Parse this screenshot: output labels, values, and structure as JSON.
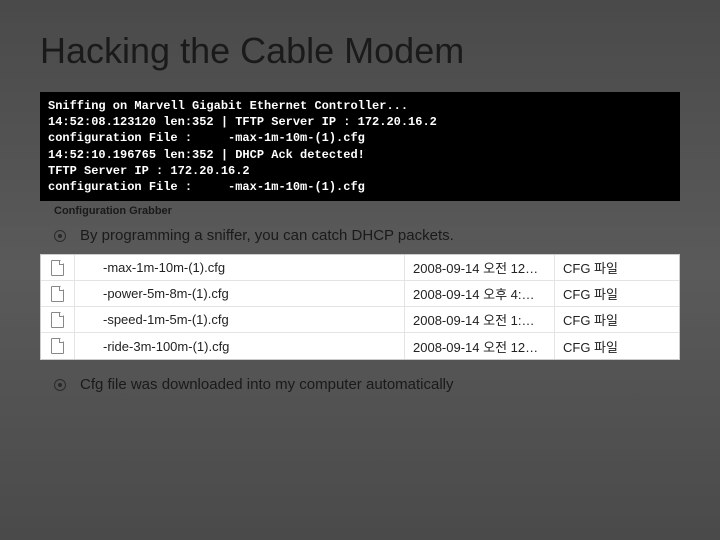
{
  "title": "Hacking the Cable Modem",
  "terminal": {
    "line1": "Sniffing on Marvell Gigabit Ethernet Controller...",
    "line2": "14:52:08.123120 len:352 | TFTP Server IP : 172.20.16.2",
    "line3": "configuration File :     -max-1m-10m-(1).cfg",
    "line4": "14:52:10.196765 len:352 | DHCP Ack detected!",
    "line5": "TFTP Server IP : 172.20.16.2",
    "line6": "configuration File :     -max-1m-10m-(1).cfg"
  },
  "caption": "Configuration Grabber",
  "bullet1": "By programming a sniffer, you can catch DHCP packets.",
  "bullet2": "Cfg file was downloaded into my computer automatically",
  "files": [
    {
      "name": "-max-1m-10m-(1).cfg",
      "date": "2008-09-14 오전 12…",
      "type": "CFG 파일"
    },
    {
      "name": "-power-5m-8m-(1).cfg",
      "date": "2008-09-14 오후 4:…",
      "type": "CFG 파일"
    },
    {
      "name": "-speed-1m-5m-(1).cfg",
      "date": "2008-09-14 오전 1:…",
      "type": "CFG 파일"
    },
    {
      "name": "-ride-3m-100m-(1).cfg",
      "date": "2008-09-14 오전 12…",
      "type": "CFG 파일"
    }
  ]
}
